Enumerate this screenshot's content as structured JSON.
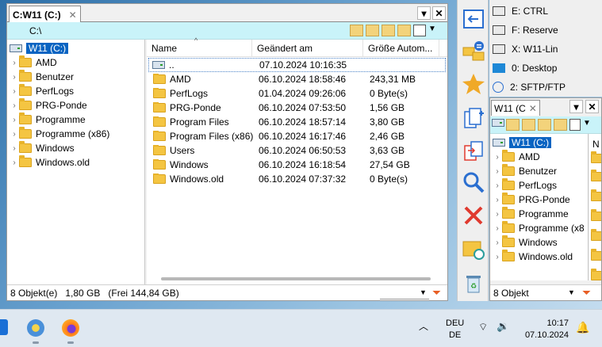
{
  "left_panel": {
    "tab_title": "C:W11 (C:)",
    "path": "C:\\",
    "tree": {
      "root_label": "W11 (C:)",
      "items": [
        "AMD",
        "Benutzer",
        "PerfLogs",
        "PRG-Ponde",
        "Programme",
        "Programme (x86)",
        "Windows",
        "Windows.old"
      ]
    },
    "columns": {
      "name": "Name",
      "modified": "Geändert am",
      "size": "Größe Autom..."
    },
    "parent_row": {
      "name": "..",
      "modified": "07.10.2024 10:16:35",
      "size": ""
    },
    "files": [
      {
        "name": "AMD",
        "modified": "06.10.2024 18:58:46",
        "size": "243,31 MB"
      },
      {
        "name": "PerfLogs",
        "modified": "01.04.2024 09:26:06",
        "size": "0 Byte(s)"
      },
      {
        "name": "PRG-Ponde",
        "modified": "06.10.2024 07:53:50",
        "size": "1,56 GB"
      },
      {
        "name": "Program Files",
        "modified": "06.10.2024 18:57:14",
        "size": "3,80 GB"
      },
      {
        "name": "Program Files (x86)",
        "modified": "06.10.2024 16:17:46",
        "size": "2,46 GB"
      },
      {
        "name": "Users",
        "modified": "06.10.2024 06:50:53",
        "size": "3,63 GB"
      },
      {
        "name": "Windows",
        "modified": "06.10.2024 16:18:54",
        "size": "27,54 GB"
      },
      {
        "name": "Windows.old",
        "modified": "06.10.2024 07:37:32",
        "size": "0 Byte(s)"
      }
    ],
    "status": "8 Objekt(e)   1,80 GB   (Frei 144,84 GB)"
  },
  "drives": [
    {
      "label": "E: CTRL",
      "icon": "drive-icon"
    },
    {
      "label": "F: Reserve",
      "icon": "drive-icon"
    },
    {
      "label": "X: W11-Lin",
      "icon": "drive-icon"
    },
    {
      "label": "0: Desktop",
      "icon": "desktop-icon"
    },
    {
      "label": "2: SFTP/FTP",
      "icon": "globe-icon"
    }
  ],
  "right_panel": {
    "tab_title": "W11 (C",
    "tree": {
      "root_label": "W11 (C:)",
      "items": [
        "AMD",
        "Benutzer",
        "PerfLogs",
        "PRG-Ponde",
        "Programme",
        "Programme (x8",
        "Windows",
        "Windows.old"
      ]
    },
    "col_hint": "N",
    "status": "8 Objekt"
  },
  "taskbar": {
    "lang_line1": "DEU",
    "lang_line2": "DE",
    "time": "10:17",
    "date": "07.10.2024"
  },
  "colors": {
    "path_bg": "#c9f3f9",
    "selection": "#0a64c2",
    "folder": "#f4c542",
    "accent_red": "#e03a2f",
    "accent_blue": "#2b6fd0"
  }
}
